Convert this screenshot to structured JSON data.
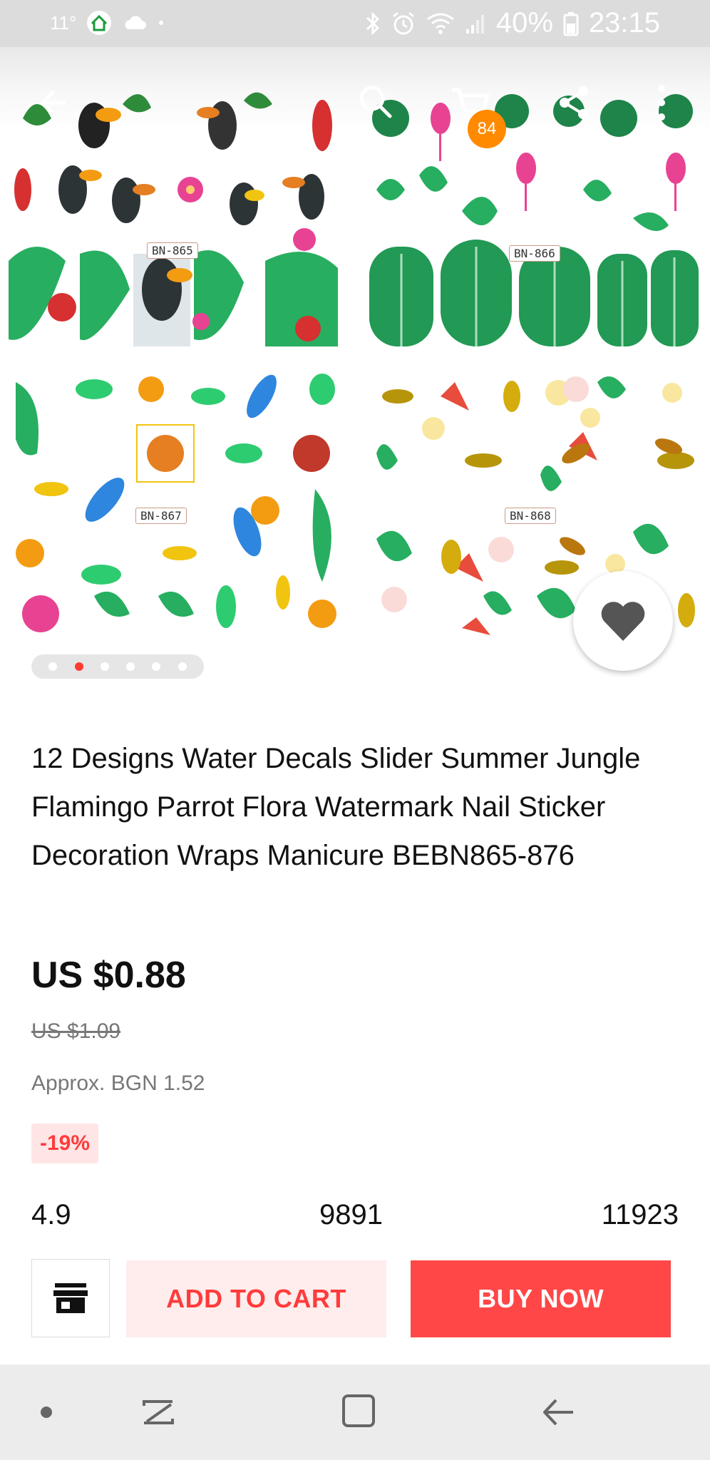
{
  "status_bar": {
    "temperature": "11°",
    "battery_percent": "40%",
    "time": "23:15"
  },
  "gallery": {
    "codes": [
      "BN-865",
      "BN-866",
      "BN-867",
      "BN-868"
    ],
    "cart_count": "84",
    "slide_count": 6,
    "active_slide": 1
  },
  "product": {
    "title": "12 Designs Water Decals Slider Summer Jungle Flamingo Parrot Flora Watermark Nail Sticker Decoration Wraps Manicure BEBN865-876",
    "price": "US $0.88",
    "original_price": "US $1.09",
    "approx_price": "Approx. BGN 1.52",
    "discount": "-19%"
  },
  "stats": {
    "rating": "4.9",
    "reviews": "9891",
    "orders": "11923"
  },
  "actions": {
    "add_to_cart": "ADD TO CART",
    "buy_now": "BUY NOW"
  },
  "colors": {
    "accent_red": "#ff4747",
    "cart_badge": "#ff8a00",
    "discount_bg": "#ffe5e5"
  }
}
